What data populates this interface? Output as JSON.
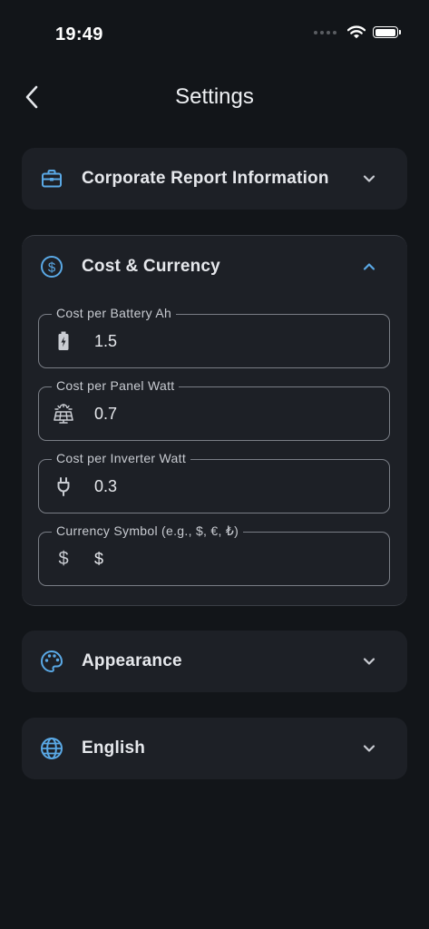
{
  "status": {
    "time": "19:49"
  },
  "nav": {
    "title": "Settings"
  },
  "sections": {
    "corporate": {
      "title": "Corporate Report Information",
      "icon": "briefcase-icon",
      "expanded": false
    },
    "cost": {
      "title": "Cost & Currency",
      "icon": "dollar-circle-icon",
      "expanded": true,
      "fields": [
        {
          "label": "Cost per Battery Ah",
          "value": "1.5",
          "icon": "battery-charging-icon"
        },
        {
          "label": "Cost per Panel Watt",
          "value": "0.7",
          "icon": "solar-panel-icon"
        },
        {
          "label": "Cost per Inverter Watt",
          "value": "0.3",
          "icon": "plug-icon"
        },
        {
          "label": "Currency Symbol (e.g., $, €, ₺)",
          "value": "$",
          "icon": "dollar-sign-icon"
        }
      ]
    },
    "appearance": {
      "title": "Appearance",
      "icon": "palette-icon",
      "expanded": false
    },
    "language": {
      "title": "English",
      "icon": "globe-icon",
      "expanded": false
    }
  },
  "colors": {
    "accent": "#5aa9e6",
    "background": "#121519",
    "card": "#1d2026"
  }
}
